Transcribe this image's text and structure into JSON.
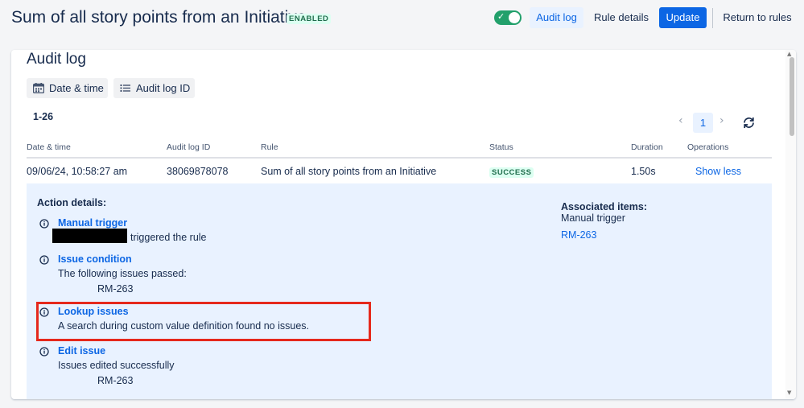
{
  "header": {
    "title": "Sum of all story points from an Initiative",
    "status_badge": "ENABLED",
    "toggle_enabled": true,
    "audit_log_label": "Audit log",
    "rule_details_label": "Rule details",
    "update_label": "Update",
    "return_label": "Return to rules"
  },
  "audit": {
    "title": "Audit log",
    "filters": [
      {
        "label": "Date & time",
        "icon": "calendar-icon"
      },
      {
        "label": "Audit log ID",
        "icon": "list-icon"
      }
    ],
    "range": "1-26",
    "pagination": {
      "current_page": "1"
    },
    "columns": [
      "Date & time",
      "Audit log ID",
      "Rule",
      "Status",
      "Duration",
      "Operations"
    ],
    "row": {
      "date": "09/06/24, 10:58:27 am",
      "audit_id": "38069878078",
      "rule": "Sum of all story points from an Initiative",
      "status": "SUCCESS",
      "duration": "1.50s",
      "operation": "Show less"
    },
    "details": {
      "title": "Action details:",
      "actions": [
        {
          "name": "Manual trigger",
          "text": "triggered the rule",
          "issue": ""
        },
        {
          "name": "Issue condition",
          "text": "The following issues passed:",
          "issue": "RM-263"
        },
        {
          "name": "Lookup issues",
          "text": "A search during custom value definition found no issues.",
          "issue": ""
        },
        {
          "name": "Edit issue",
          "text": "Issues edited successfully",
          "issue": "RM-263"
        }
      ],
      "associated": {
        "title": "Associated items:",
        "subtitle": "Manual trigger",
        "link": "RM-263"
      }
    }
  },
  "colors": {
    "primary": "#0c66e4",
    "success_bg": "#dcfff1",
    "success_text": "#216e4e",
    "details_bg": "#e9f2ff",
    "highlight": "#e5291d",
    "toggle_on": "#22a06b"
  }
}
